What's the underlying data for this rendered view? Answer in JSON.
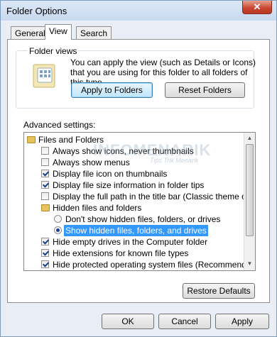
{
  "window": {
    "title": "Folder Options",
    "close_glyph": "✕"
  },
  "tabs": [
    "General",
    "View",
    "Search"
  ],
  "folder_views": {
    "legend": "Folder views",
    "description": "You can apply the view (such as Details or Icons) that you are using for this folder to all folders of this type.",
    "apply_label": "Apply to Folders",
    "reset_label": "Reset Folders"
  },
  "advanced": {
    "label": "Advanced settings:",
    "items": [
      {
        "type": "folder",
        "text": "Files and Folders"
      },
      {
        "type": "checkbox",
        "checked": false,
        "text": "Always show icons, never thumbnails"
      },
      {
        "type": "checkbox",
        "checked": false,
        "text": "Always show menus"
      },
      {
        "type": "checkbox",
        "checked": true,
        "text": "Display file icon on thumbnails"
      },
      {
        "type": "checkbox",
        "checked": true,
        "text": "Display file size information in folder tips"
      },
      {
        "type": "checkbox",
        "checked": false,
        "text": "Display the full path in the title bar (Classic theme only)"
      },
      {
        "type": "folder",
        "text": "Hidden files and folders"
      },
      {
        "type": "radio",
        "checked": false,
        "text": "Don't show hidden files, folders, or drives"
      },
      {
        "type": "radio",
        "checked": true,
        "selected": true,
        "text": "Show hidden files, folders, and drives"
      },
      {
        "type": "checkbox",
        "checked": true,
        "text": "Hide empty drives in the Computer folder"
      },
      {
        "type": "checkbox",
        "checked": true,
        "text": "Hide extensions for known file types"
      },
      {
        "type": "checkbox",
        "checked": true,
        "text": "Hide protected operating system files (Recommended)"
      }
    ],
    "restore_label": "Restore Defaults"
  },
  "watermark": {
    "main": "INFOMENARIK",
    "sub": "Tips Trik Menarik"
  },
  "footer": {
    "ok": "OK",
    "cancel": "Cancel",
    "apply": "Apply"
  }
}
